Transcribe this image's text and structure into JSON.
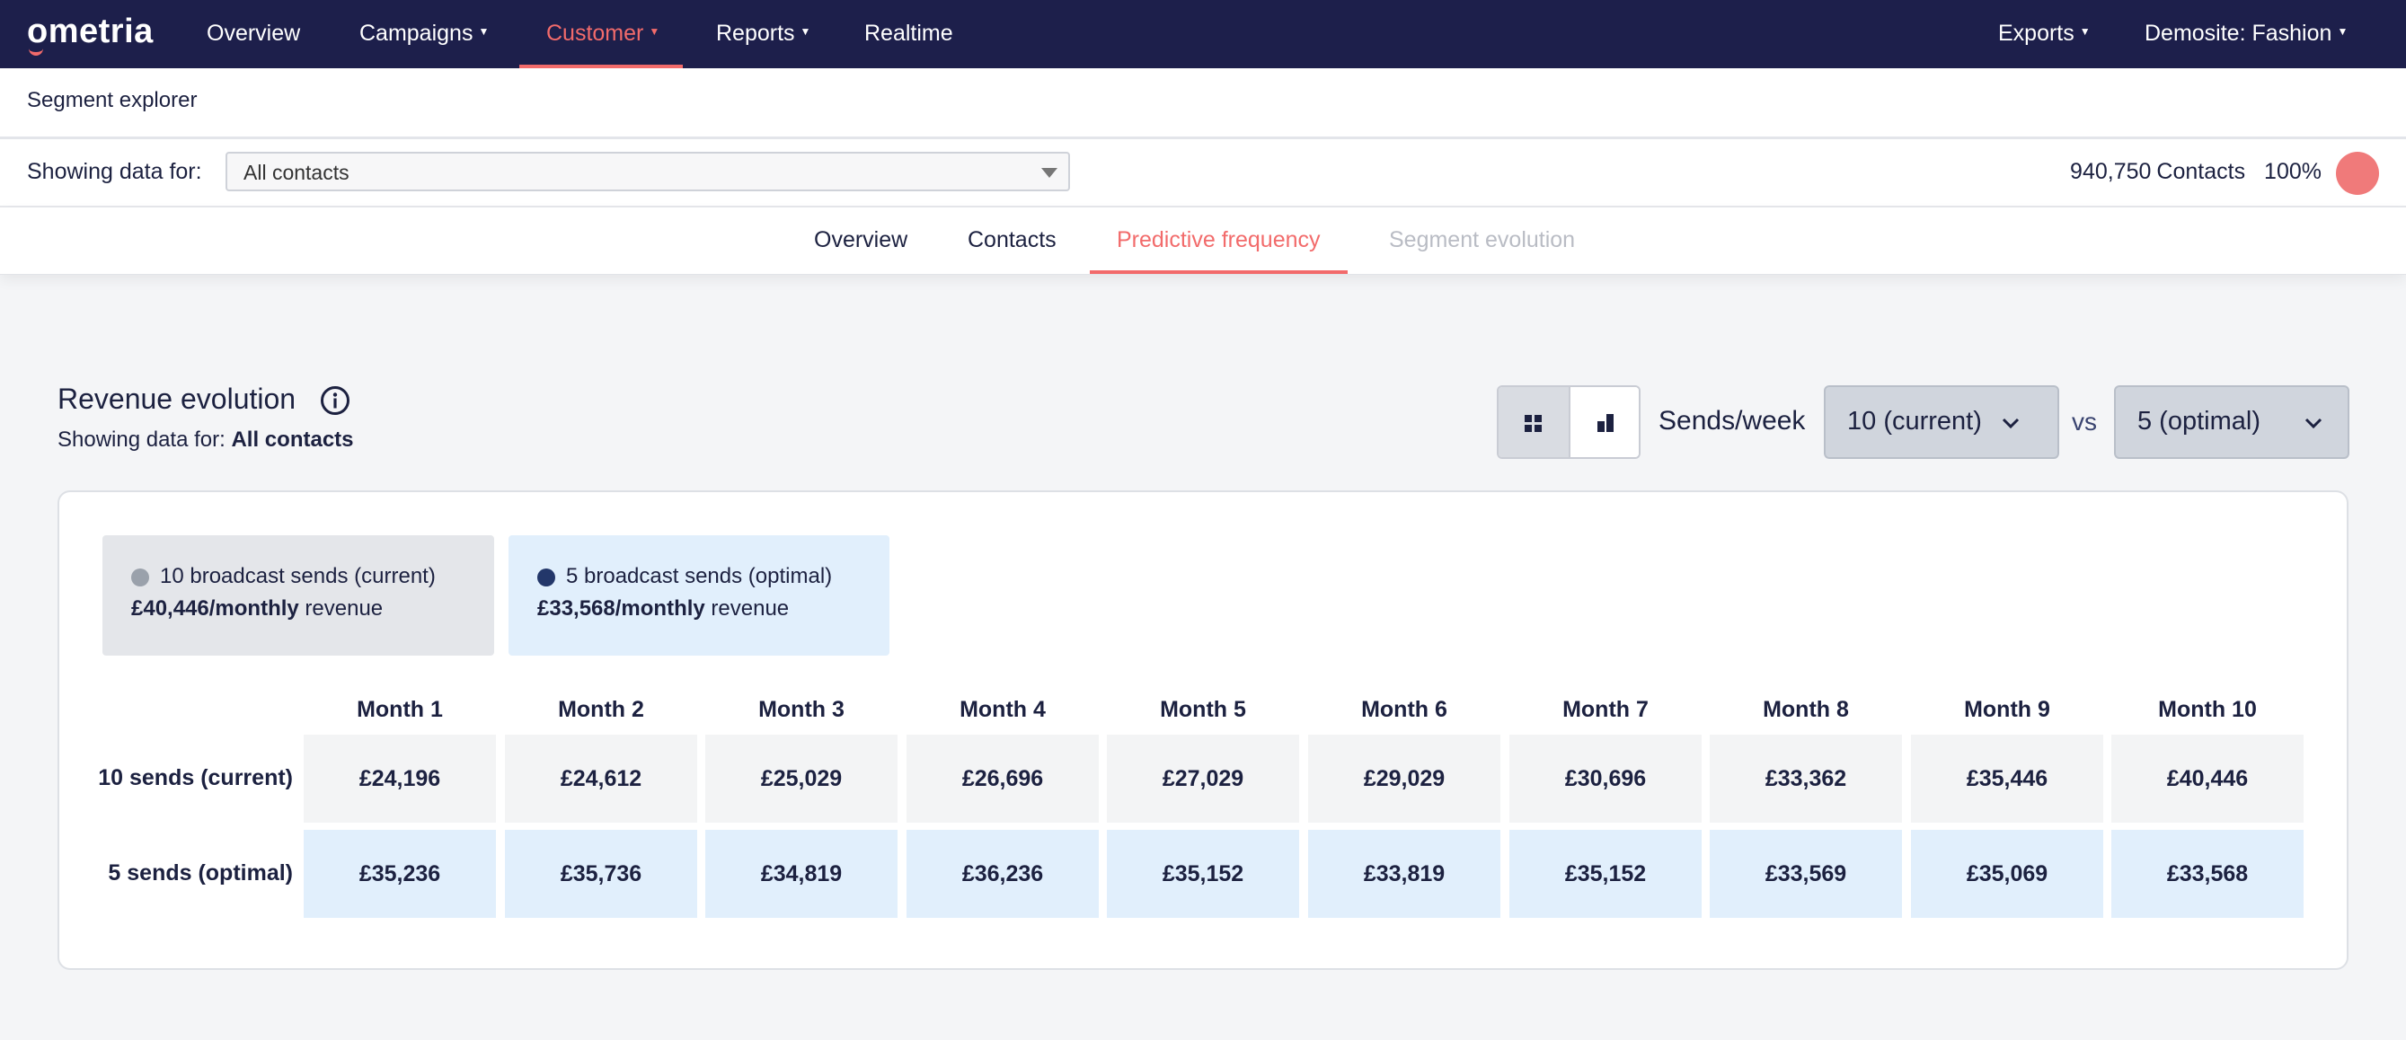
{
  "nav": {
    "logo": "ometria",
    "items": [
      {
        "label": "Overview",
        "caret": false
      },
      {
        "label": "Campaigns",
        "caret": true
      },
      {
        "label": "Customer",
        "caret": true
      },
      {
        "label": "Reports",
        "caret": true
      },
      {
        "label": "Realtime",
        "caret": false
      }
    ],
    "right": [
      {
        "label": "Exports"
      },
      {
        "label": "Demosite: Fashion"
      }
    ]
  },
  "page": {
    "title": "Segment explorer"
  },
  "filter": {
    "label": "Showing data for:",
    "selected": "All contacts",
    "contacts_count": "940,750",
    "contacts_word": "Contacts",
    "percent": "100%",
    "status_color": "#f07a7a"
  },
  "tabs": [
    {
      "label": "Overview",
      "state": "normal"
    },
    {
      "label": "Contacts",
      "state": "normal"
    },
    {
      "label": "Predictive frequency",
      "state": "active"
    },
    {
      "label": "Segment evolution",
      "state": "disabled"
    }
  ],
  "section": {
    "title": "Revenue evolution",
    "subtitle_prefix": "Showing data for:",
    "subtitle_value": "All contacts"
  },
  "controls": {
    "sends_label": "Sends/week",
    "current_select": "10 (current)",
    "vs": "vs",
    "optimal_select": "5 (optimal)"
  },
  "legend": {
    "current": {
      "name": "10 broadcast sends (current)",
      "revenue": "£40,446/monthly",
      "suffix": "revenue",
      "color": "#9aa1ab"
    },
    "optimal": {
      "name": "5 broadcast sends (optimal)",
      "revenue": "£33,568/monthly",
      "suffix": "revenue",
      "color": "#23376a"
    }
  },
  "table": {
    "months": [
      "Month 1",
      "Month 2",
      "Month 3",
      "Month 4",
      "Month 5",
      "Month 6",
      "Month 7",
      "Month 8",
      "Month 9",
      "Month 10"
    ],
    "rows": [
      {
        "label": "10 sends (current)",
        "values": [
          "£24,196",
          "£24,612",
          "£25,029",
          "£26,696",
          "£27,029",
          "£29,029",
          "£30,696",
          "£33,362",
          "£35,446",
          "£40,446"
        ]
      },
      {
        "label": "5 sends (optimal)",
        "values": [
          "£35,236",
          "£35,736",
          "£34,819",
          "£36,236",
          "£35,152",
          "£33,819",
          "£35,152",
          "£33,569",
          "£35,069",
          "£33,568"
        ]
      }
    ]
  }
}
